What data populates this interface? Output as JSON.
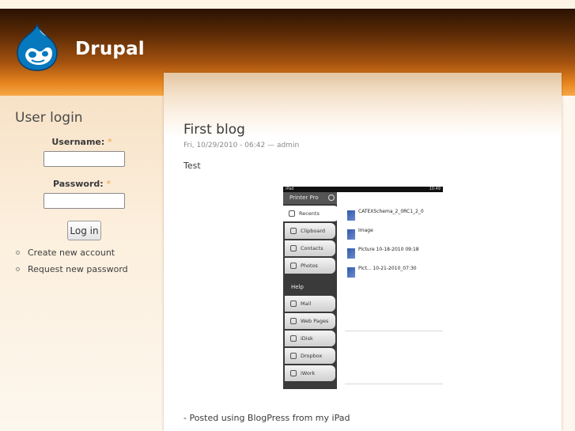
{
  "site": {
    "name": "Drupal"
  },
  "login": {
    "title": "User login",
    "username_label": "Username:",
    "password_label": "Password:",
    "required_mark": "*",
    "button": "Log in",
    "links": [
      "Create new account",
      "Request new password"
    ]
  },
  "post": {
    "title": "First blog",
    "meta": "Fri, 10/29/2010 - 06:42 — admin",
    "body": "Test",
    "footer": "- Posted using BlogPress from my iPad"
  },
  "ipad": {
    "status_left": "iPad",
    "status_time": "10:49",
    "app_title": "Printer Pro",
    "tabs": [
      "Recents",
      "Clipboard",
      "Contacts",
      "Photos"
    ],
    "section": "Help",
    "tabs2": [
      "Mail",
      "Web Pages",
      "iDisk",
      "Dropbox",
      "iWork"
    ],
    "files": [
      {
        "name": "CATEXSchema_2_0RC1_2_0",
        "size": ""
      },
      {
        "name": "Image",
        "size": ""
      },
      {
        "name": "Picture 10-18-2010 09:18",
        "size": ""
      },
      {
        "name": "Pict... 10-21-2010_07:30",
        "size": ""
      }
    ]
  },
  "colors": {
    "header_dark": "#2a1202",
    "header_light": "#f6a847",
    "required": "#f0a33b",
    "logo_blue": "#0678be"
  }
}
